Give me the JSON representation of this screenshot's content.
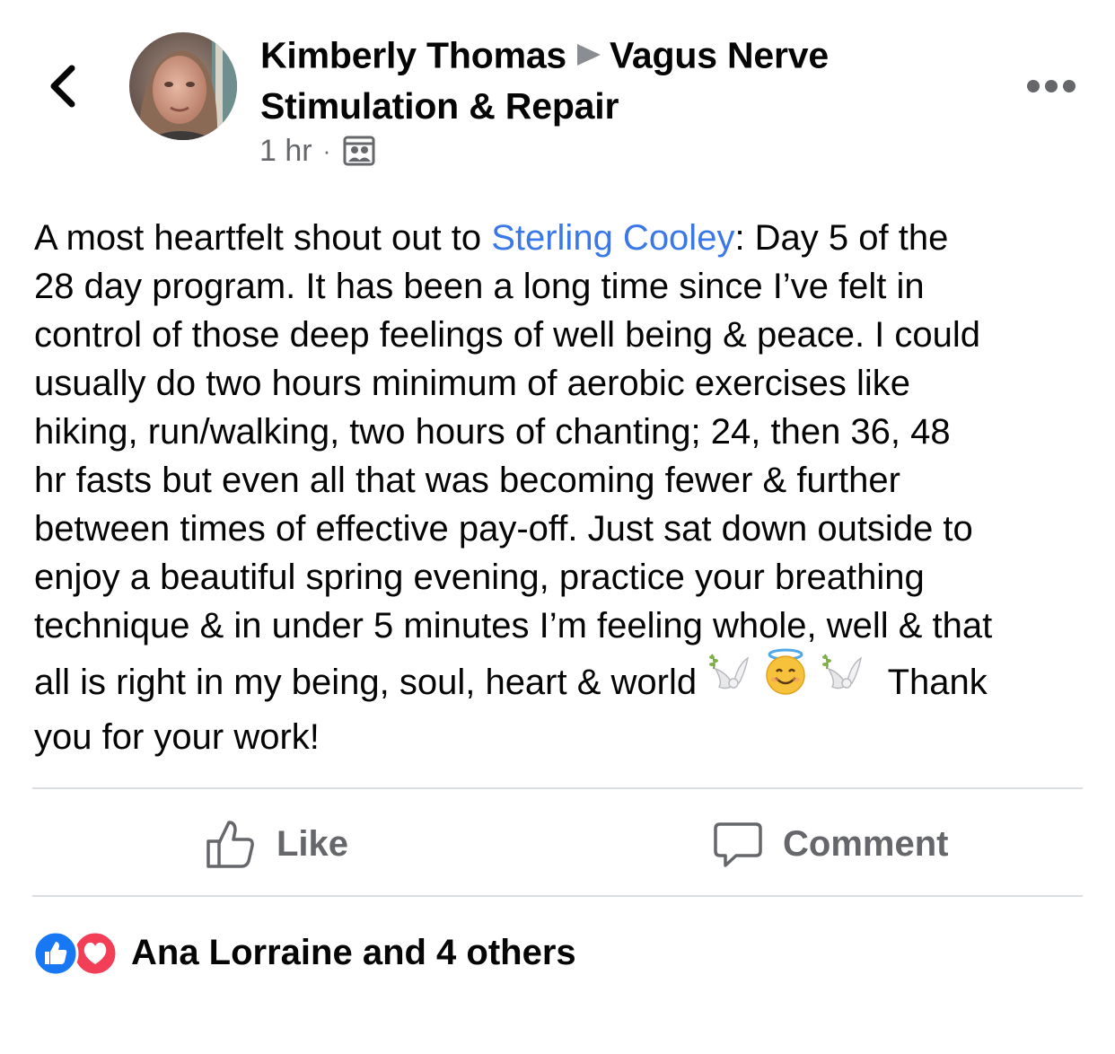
{
  "header": {
    "author_name": "Kimberly Thomas",
    "group_name_line1": "Vagus Nerve",
    "group_name_line2": "Stimulation & Repair",
    "timestamp": "1 hr",
    "separator": "·",
    "audience_icon": "group-members-icon",
    "back_icon": "chevron-left-icon",
    "more_icon": "more-options-icon"
  },
  "post": {
    "line1_pre": "A most heartfelt shout out to ",
    "mention": "Sterling Cooley",
    "line1_post": ": Day 5 of the",
    "line2": "28 day program. It has  been a long time since I’ve felt in",
    "line3": "control of those deep feelings of well being & peace. I could",
    "line4": "usually do two hours minimum of aerobic exercises like",
    "line5": "hiking, run/walking, two hours of chanting; 24, then 36, 48",
    "line6": "hr fasts but even all that was becoming fewer & further",
    "line7": "between times of effective pay-off. Just sat down outside to",
    "line8": "enjoy a beautiful spring evening, practice your breathing",
    "line9": "technique & in under 5 minutes I’m feeling whole, well & that",
    "line10_pre": "all is right in my being, soul, heart & world",
    "line10_post": "Thank",
    "line11": "you for your work!",
    "emojis": [
      "dove-emoji",
      "halo-smile-emoji",
      "dove-emoji"
    ]
  },
  "actions": {
    "like_label": "Like",
    "comment_label": "Comment"
  },
  "reactions": {
    "summary": "Ana Lorraine and 4 others",
    "icons": [
      "like-reaction-icon",
      "love-reaction-icon"
    ]
  },
  "colors": {
    "mention": "#3b78e7",
    "secondary_text": "#65676b",
    "like_blue": "#1877f2",
    "love_red": "#f33e58",
    "divider": "#dadde1"
  }
}
